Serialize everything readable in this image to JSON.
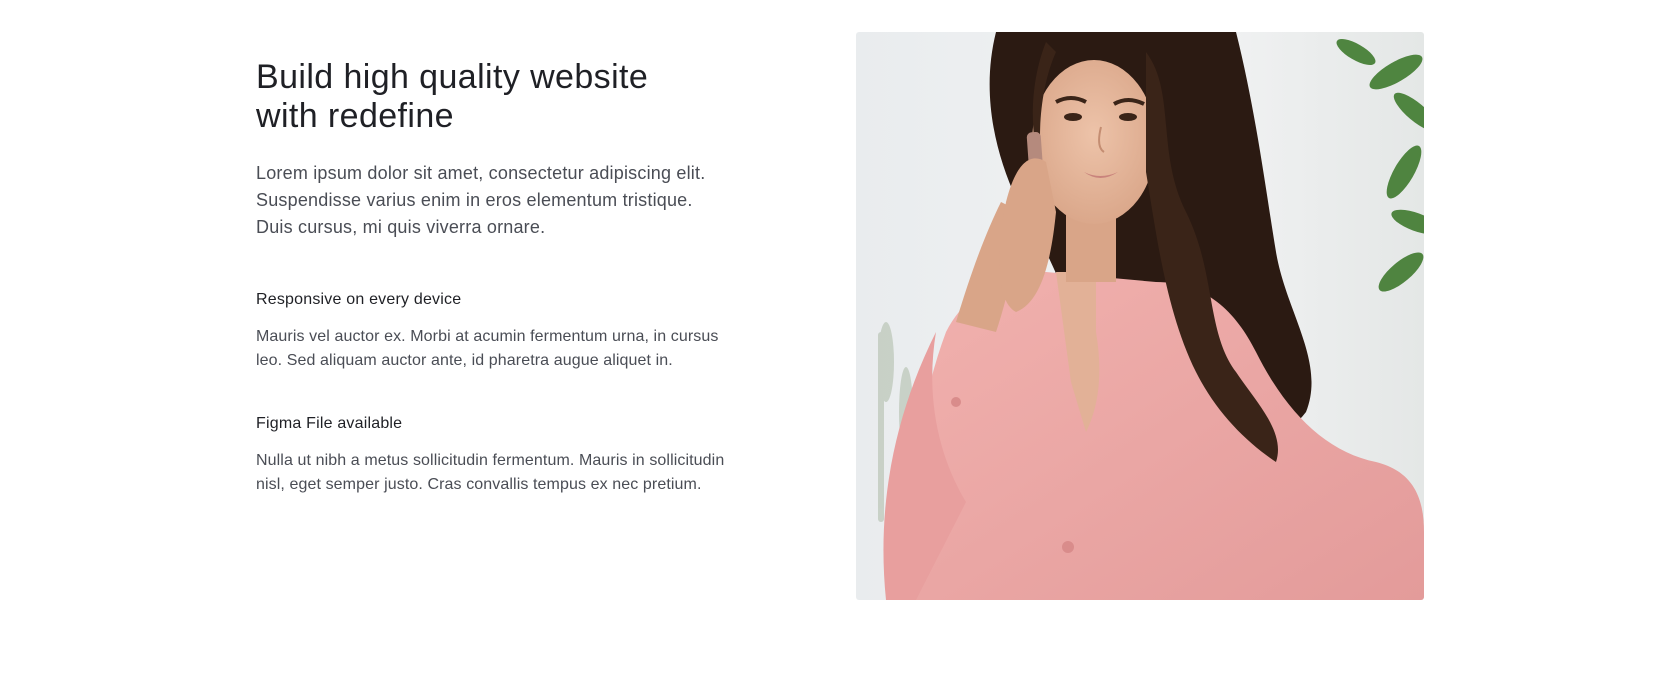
{
  "hero": {
    "heading": "Build high quality website with redefine",
    "lead": "Lorem ipsum dolor sit amet, consectetur adipiscing elit. Suspendisse varius enim in eros elementum tristique. Duis cursus, mi quis viverra ornare."
  },
  "features": [
    {
      "title": "Responsive on every device",
      "description": "Mauris vel auctor ex. Morbi at acumin fermentum urna, in cursus leo. Sed aliquam auctor ante, id pharetra augue aliquet in."
    },
    {
      "title": "Figma File available",
      "description": "Nulla ut nibh a metus sollicitudin fermentum. Mauris in sollicitudin nisl, eget semper justo. Cras convallis tempus ex nec pretium."
    }
  ],
  "colors": {
    "heading": "#1f2025",
    "body_text": "#4a4d55",
    "shirt_pink": "#eca6a6",
    "hair": "#2b1a12",
    "skin": "#e6b79d",
    "plant": "#3f7a2e"
  }
}
